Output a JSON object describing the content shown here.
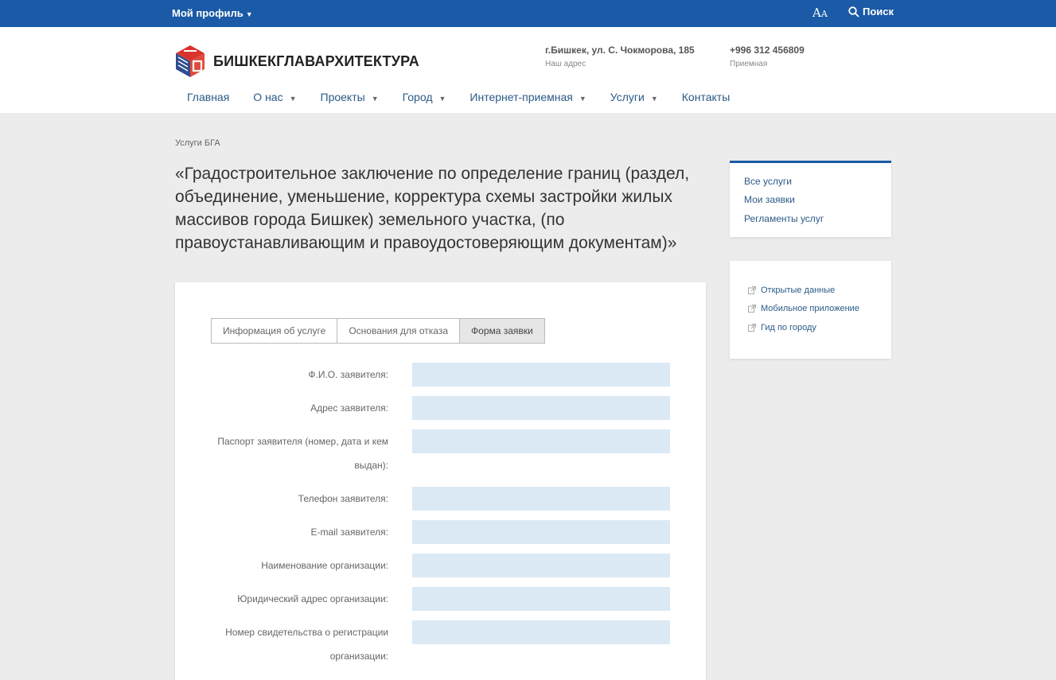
{
  "topbar": {
    "profile_label": "Мой профиль",
    "font_size_label_big": "A",
    "font_size_label_small": "A",
    "search_label": "Поиск"
  },
  "header": {
    "logo_text": "БИШКЕКГЛАВАРХИТЕКТУРА",
    "address": "г.Бишкек, ул. С. Чокморова, 185",
    "address_caption": "Наш адрес",
    "phone": "+996 312 456809",
    "phone_caption": "Приемная"
  },
  "nav": {
    "items": [
      {
        "label": "Главная"
      },
      {
        "label": "О нас"
      },
      {
        "label": "Проекты"
      },
      {
        "label": "Город"
      },
      {
        "label": "Интернет-приемная"
      },
      {
        "label": "Услуги"
      },
      {
        "label": "Контакты"
      }
    ]
  },
  "breadcrumb": "Услуги БГА",
  "page_title": "«Градостроительное заключение по определение границ (раздел, объединение, уменьшение, корректура схемы застройки жилых массивов города Бишкек) земельного участка, (по правоустанавливающим и правоудостоверяющим документам)»",
  "tabs": [
    {
      "label": "Информация об услуге"
    },
    {
      "label": "Основания для отказа"
    },
    {
      "label": "Форма заявки"
    }
  ],
  "form": {
    "fields": [
      {
        "label": "Ф.И.О. заявителя:",
        "value": ""
      },
      {
        "label": "Адрес заявителя:",
        "value": ""
      },
      {
        "label": "Паспорт заявителя (номер, дата и кем выдан):",
        "value": ""
      },
      {
        "label": "Телефон заявителя:",
        "value": ""
      },
      {
        "label": "E-mail заявителя:",
        "value": ""
      },
      {
        "label": "Наименование организации:",
        "value": ""
      },
      {
        "label": "Юридический адрес организации:",
        "value": ""
      },
      {
        "label": "Номер свидетельства о регистрации организации:",
        "value": ""
      }
    ]
  },
  "sidebar": {
    "services_links": [
      {
        "label": "Все услуги"
      },
      {
        "label": "Мои заявки"
      },
      {
        "label": "Регламенты услуг"
      }
    ],
    "external_links": [
      {
        "label": "Открытые данные"
      },
      {
        "label": "Мобильное приложение"
      },
      {
        "label": "Гид по городу"
      }
    ]
  },
  "colors": {
    "brand_blue": "#1a5aa6",
    "input_fill": "#dbe9f5",
    "link": "#2b5a87"
  }
}
